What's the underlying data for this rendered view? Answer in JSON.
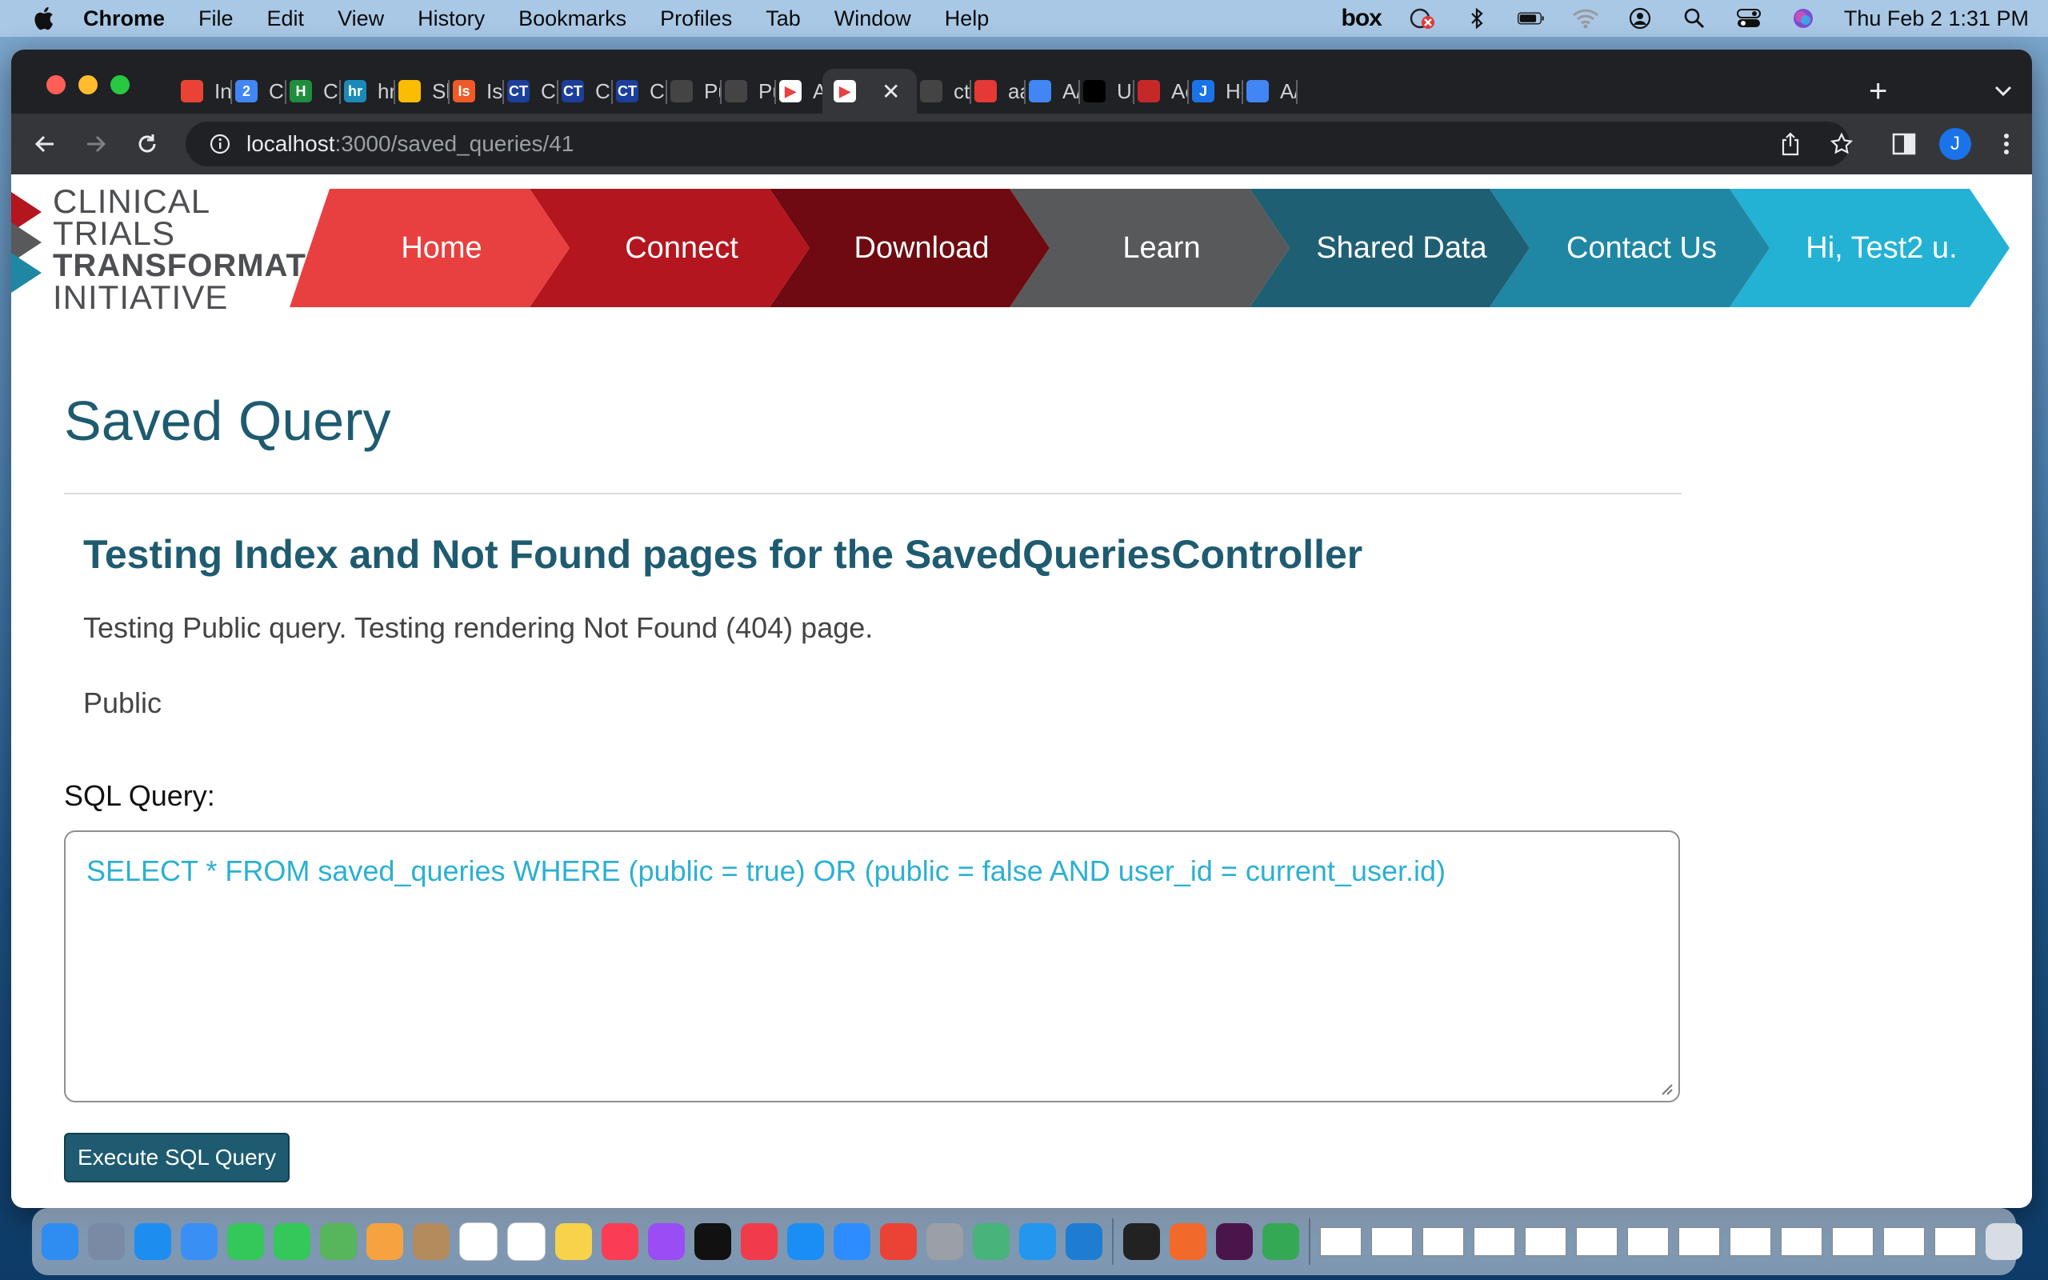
{
  "menubar": {
    "app_name": "Chrome",
    "items": [
      "File",
      "Edit",
      "View",
      "History",
      "Bookmarks",
      "Profiles",
      "Tab",
      "Window",
      "Help"
    ],
    "box_label": "box",
    "clock": "Thu Feb 2  1:31 PM"
  },
  "browser": {
    "tabs": [
      {
        "label": "Int",
        "icon": "gmail-icon",
        "color": "#ea4335"
      },
      {
        "label": "Co",
        "icon": "calendar-icon",
        "color": "#4285f4",
        "glyph": "2"
      },
      {
        "label": "Co",
        "icon": "h-icon",
        "color": "#1e8e3e",
        "glyph": "H"
      },
      {
        "label": "hr",
        "icon": "hr-icon",
        "color": "#1a8bb8",
        "glyph": "hr"
      },
      {
        "label": "Sh",
        "icon": "drive-icon",
        "color": "#fbbc04"
      },
      {
        "label": "Iss",
        "icon": "issues-icon",
        "color": "#f05a28",
        "glyph": "Is"
      },
      {
        "label": "Cli",
        "icon": "ct-icon",
        "color": "#1c3f9c",
        "glyph": "CT"
      },
      {
        "label": "Cl",
        "icon": "ct-icon",
        "color": "#1c3f9c",
        "glyph": "CT"
      },
      {
        "label": "Cl",
        "icon": "ct-icon",
        "color": "#1c3f9c",
        "glyph": "CT"
      },
      {
        "label": "Pu",
        "icon": "github-icon",
        "color": "#444"
      },
      {
        "label": "Pu",
        "icon": "github-icon",
        "color": "#444"
      },
      {
        "label": "AA",
        "icon": "app-icon",
        "color": "#ffffff"
      },
      {
        "label": "",
        "icon": "app-icon",
        "color": "#ffffff",
        "active": true
      },
      {
        "label": "ct",
        "icon": "github-icon",
        "color": "#444"
      },
      {
        "label": "aa",
        "icon": "red-app-icon",
        "color": "#e53935"
      },
      {
        "label": "A/",
        "icon": "docs-icon",
        "color": "#4285f4"
      },
      {
        "label": "Us",
        "icon": "chevrons-icon",
        "color": "#000000"
      },
      {
        "label": "Ac",
        "icon": "ruby-icon",
        "color": "#c62828"
      },
      {
        "label": "He",
        "icon": "j-icon",
        "color": "#1a73e8",
        "glyph": "J"
      },
      {
        "label": "A/",
        "icon": "docs-icon",
        "color": "#4285f4"
      }
    ],
    "close_glyph": "✕",
    "new_tab_glyph": "+",
    "tab_search_glyph": "⌄",
    "url_host": "localhost",
    "url_rest": ":3000/saved_queries/41",
    "avatar_letter": "J"
  },
  "site": {
    "logo_lines": [
      "CLINICAL",
      "TRIALS",
      "TRANSFORMATION",
      "INITIATIVE"
    ],
    "nav": [
      {
        "label": "Home",
        "color": "#e84040"
      },
      {
        "label": "Connect",
        "color": "#b3161f"
      },
      {
        "label": "Download",
        "color": "#6e0a10"
      },
      {
        "label": "Learn",
        "color": "#58595b"
      },
      {
        "label": "Shared Data",
        "color": "#1f5f73"
      },
      {
        "label": "Contact Us",
        "color": "#1f87a3"
      },
      {
        "label": "Hi, Test2 u.",
        "color": "#23b2d4"
      }
    ]
  },
  "main": {
    "page_title": "Saved Query",
    "query_name": "Testing Index and Not Found pages for the SavedQueriesController",
    "query_description": "Testing Public query. Testing rendering Not Found (404) page.",
    "visibility": "Public",
    "sql_label": "SQL Query:",
    "sql_text": "SELECT * FROM saved_queries WHERE (public = true) OR (public = false AND user_id = current_user.id)",
    "execute_button": "Execute SQL Query"
  }
}
